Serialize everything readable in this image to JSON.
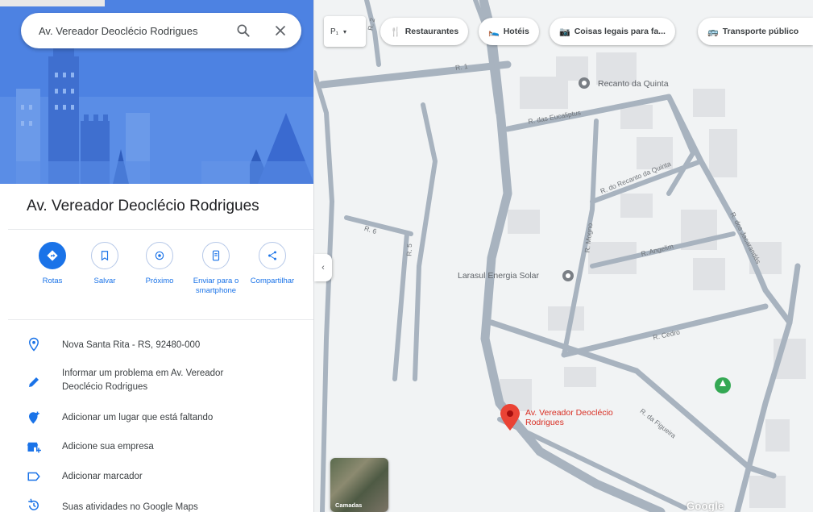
{
  "search": {
    "value": "Av. Vereador Deoclécio Rodrigues"
  },
  "place": {
    "title": "Av. Vereador Deoclécio Rodrigues"
  },
  "actions": [
    {
      "label": "Rotas",
      "icon": "directions-icon"
    },
    {
      "label": "Salvar",
      "icon": "bookmark-icon"
    },
    {
      "label": "Próximo",
      "icon": "nearby-icon"
    },
    {
      "label": "Enviar para o smartphone",
      "icon": "send-to-phone-icon"
    },
    {
      "label": "Compartilhar",
      "icon": "share-icon"
    }
  ],
  "info": [
    {
      "text": "Nova Santa Rita - RS, 92480-000",
      "icon": "location-pin-icon"
    },
    {
      "text": "Informar um problema em Av. Vereador Deoclécio Rodrigues",
      "icon": "edit-pencil-icon"
    },
    {
      "text": "Adicionar um lugar que está faltando",
      "icon": "add-place-icon"
    },
    {
      "text": "Adicione sua empresa",
      "icon": "add-business-icon"
    },
    {
      "text": "Adicionar marcador",
      "icon": "label-icon"
    },
    {
      "text": "Suas atividades no Google Maps",
      "icon": "history-icon"
    }
  ],
  "map": {
    "layer_chip": "P₁",
    "chips": [
      {
        "label": "Restaurantes",
        "icon": "restaurant-icon"
      },
      {
        "label": "Hotéis",
        "icon": "hotel-icon"
      },
      {
        "label": "Coisas legais para fa...",
        "icon": "camera-icon"
      },
      {
        "label": "Transporte público",
        "icon": "transit-icon"
      }
    ],
    "places": {
      "recanto": "Recanto da Quinta",
      "larasul": "Larasul Energia Solar",
      "pin": "Av. Vereador Deoclécio Rodrigues"
    },
    "streets": {
      "s1": "R. 1",
      "s2": "R. das Eucaliptus",
      "s3": "R. do Recanto da Quinta",
      "s4": "R. Angelim",
      "s5": "R. Cedro",
      "s6": "R. Mogno",
      "s7": "R. 6",
      "s8": "R. 5",
      "s9": "R. dos Jacarandás",
      "s10": "R. da Figueira",
      "s11": "R. 2"
    },
    "layers_label": "Camadas",
    "logo": "Google"
  },
  "colors": {
    "accent": "#1a73e8",
    "hero_bg": "#4a7fe0",
    "pin": "#ea4335",
    "park": "#34a853"
  }
}
